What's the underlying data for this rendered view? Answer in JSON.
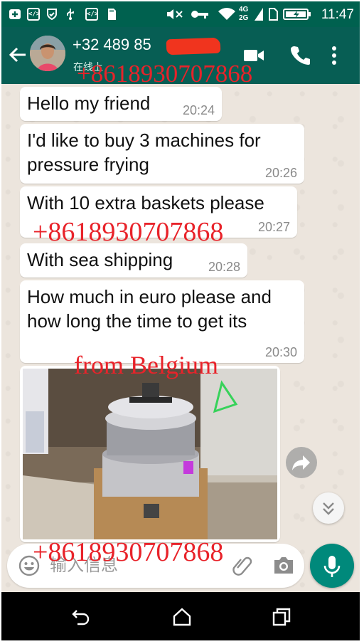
{
  "status_bar": {
    "time": "11:47",
    "network_top": "4G",
    "network_bottom": "2G"
  },
  "header": {
    "contact_number": "+32 489 85",
    "contact_status": "在线上",
    "icons": [
      "back-arrow-icon",
      "avatar",
      "video-call-icon",
      "phone-icon",
      "more-options-icon"
    ]
  },
  "messages": [
    {
      "text": "Hello my friend",
      "time": "20:24"
    },
    {
      "text": "I'd like to buy 3 machines for pressure frying",
      "time": "20:26"
    },
    {
      "text": "With 10 extra baskets please",
      "time": "20:27"
    },
    {
      "text": "With sea shipping",
      "time": "20:28"
    },
    {
      "text": "How much in euro please and how long the time to get its",
      "time": "20:30"
    }
  ],
  "input": {
    "placeholder": "输入信息"
  },
  "watermarks": {
    "phone_1": "+8618930707868",
    "phone_2": "+8618930707868",
    "from_text": "from Belgium",
    "phone_3": "+8618930707868"
  },
  "colors": {
    "status_bar": "#00614f",
    "header": "#075e54",
    "accent": "#00897b",
    "watermark": "#e8232a",
    "chat_background": "#ece5dd"
  }
}
